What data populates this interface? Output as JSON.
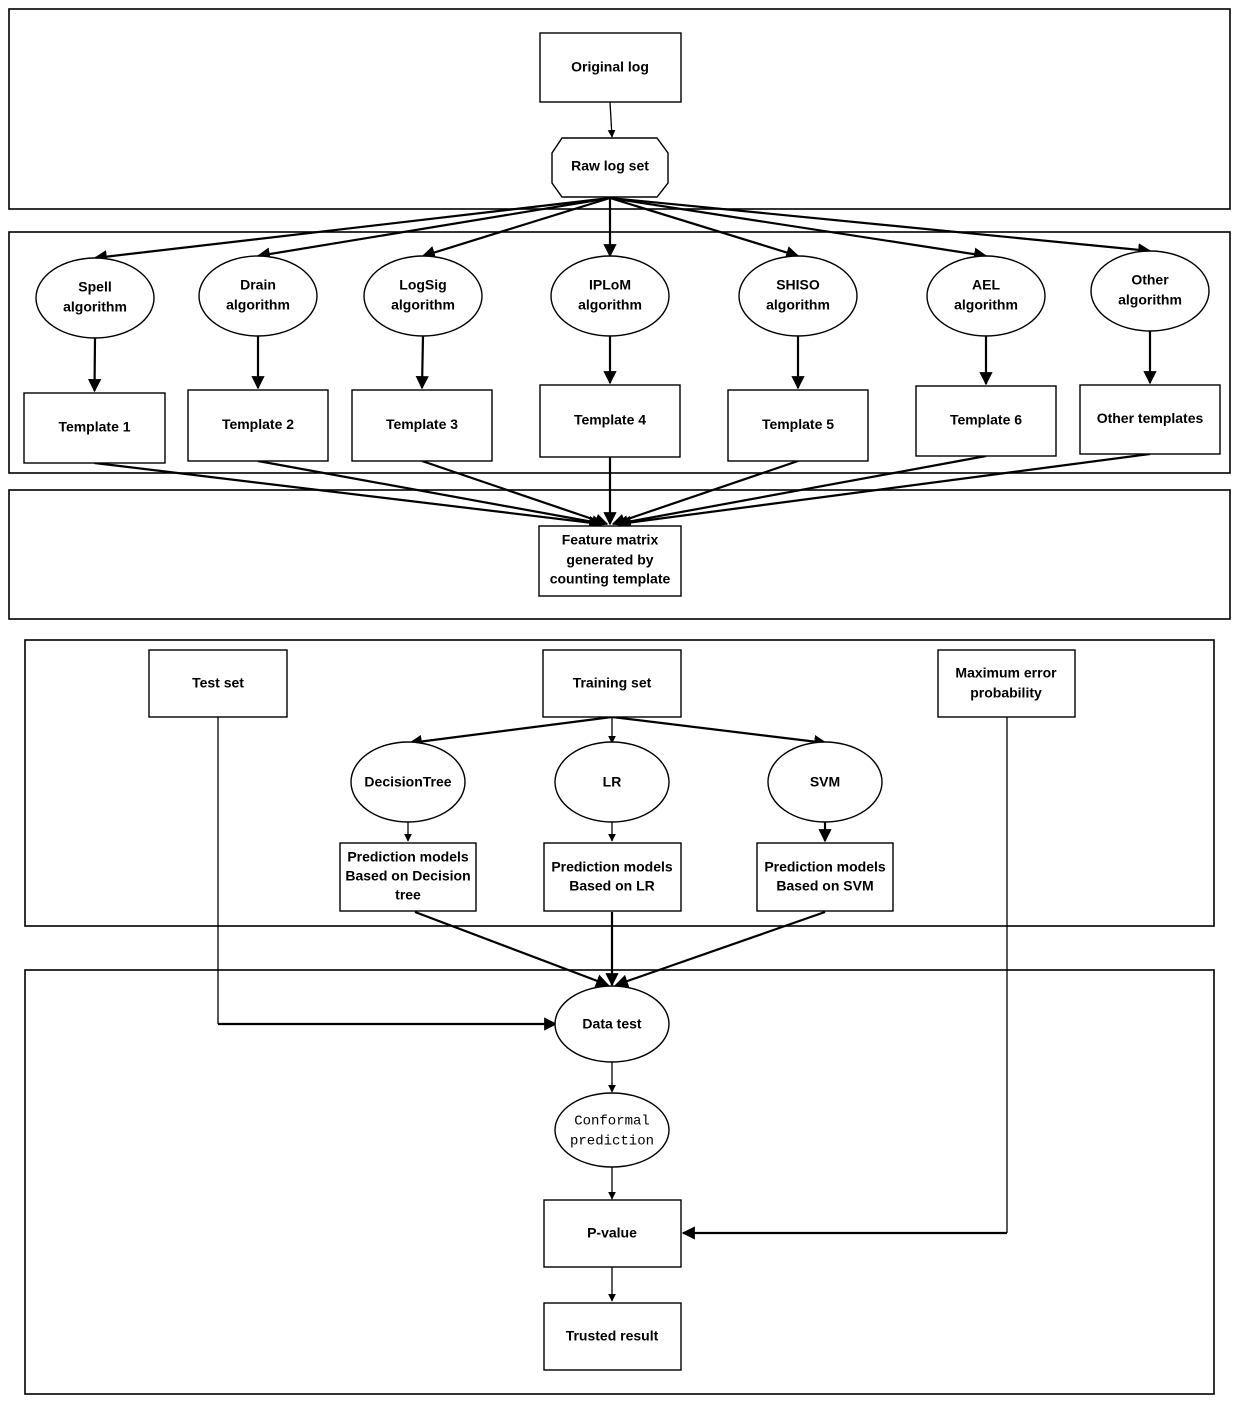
{
  "diagram": {
    "stage1": {
      "original_log": "Original log",
      "raw_log_set": "Raw log set"
    },
    "stage2": {
      "algorithms": [
        {
          "line1": "Spell",
          "line2": "algorithm"
        },
        {
          "line1": "Drain",
          "line2": "algorithm"
        },
        {
          "line1": "LogSig",
          "line2": "algorithm"
        },
        {
          "line1": "IPLoM",
          "line2": "algorithm"
        },
        {
          "line1": "SHISO",
          "line2": "algorithm"
        },
        {
          "line1": "AEL",
          "line2": "algorithm"
        },
        {
          "line1": "Other",
          "line2": "algorithm"
        }
      ],
      "templates": [
        "Template 1",
        "Template 2",
        "Template 3",
        "Template 4",
        "Template 5",
        "Template 6",
        "Other templates"
      ]
    },
    "stage3": {
      "feature_matrix": [
        "Feature matrix",
        "generated by",
        "counting template"
      ]
    },
    "stage4": {
      "test_set": "Test set",
      "training_set": "Training set",
      "max_error": [
        "Maximum error",
        "probability"
      ],
      "models": [
        "DecisionTree",
        "LR",
        "SVM"
      ],
      "predictions": [
        [
          "Prediction models",
          "Based on Decision",
          "tree"
        ],
        [
          "Prediction models",
          "Based on LR"
        ],
        [
          "Prediction models",
          "Based on SVM"
        ]
      ]
    },
    "stage5": {
      "data_test": "Data test",
      "conformal": [
        "Conformal",
        "prediction"
      ],
      "p_value": "P-value",
      "trusted_result": "Trusted result"
    }
  }
}
